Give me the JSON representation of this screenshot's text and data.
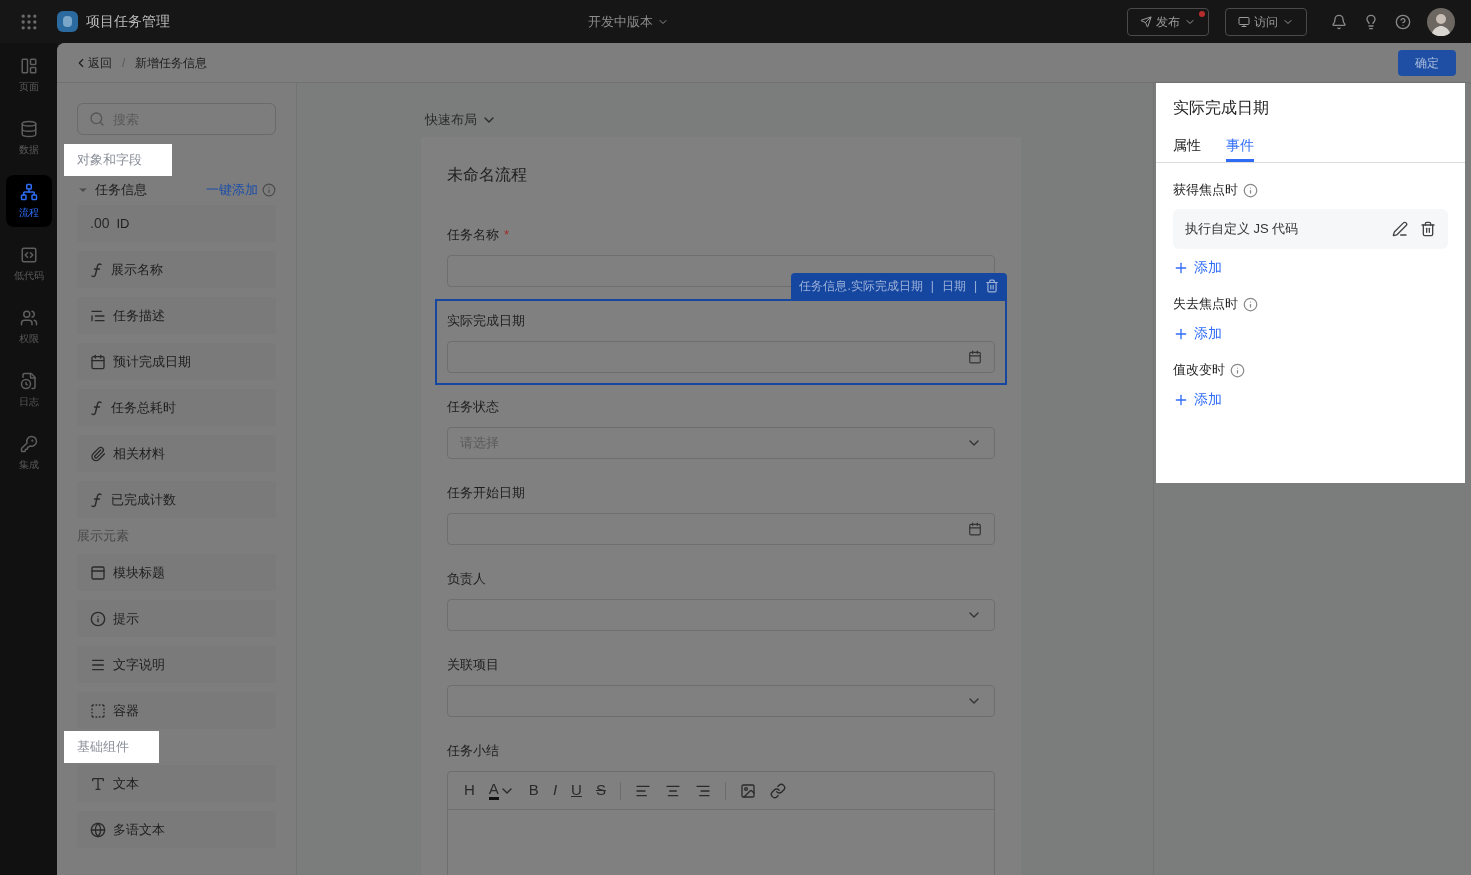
{
  "top_bar": {
    "app_title": "项目任务管理",
    "version": "开发中版本",
    "publish": {
      "label": "发布",
      "has_update": true
    },
    "visit": {
      "label": "访问"
    }
  },
  "nav": [
    {
      "label": "页面",
      "selected": false
    },
    {
      "label": "数据",
      "selected": false
    },
    {
      "label": "流程",
      "selected": true
    },
    {
      "label": "低代码",
      "selected": false
    },
    {
      "label": "权限",
      "selected": false
    },
    {
      "label": "日志",
      "selected": false
    },
    {
      "label": "集成",
      "selected": false
    }
  ],
  "header": {
    "back": "返回",
    "separator": "/",
    "page_title": "新增任务信息",
    "confirm": "确定"
  },
  "library": {
    "search_placeholder": "搜索",
    "sections": [
      {
        "title": "对象和字段",
        "highlighted": true,
        "group": {
          "title": "任务信息",
          "expanded": true,
          "action": "一键添加"
        },
        "items": [
          {
            "kind": "number",
            "glyph": ".00",
            "label": "ID"
          },
          {
            "kind": "formula",
            "label": "展示名称"
          },
          {
            "kind": "multiline",
            "label": "任务描述"
          },
          {
            "kind": "date",
            "label": "预计完成日期"
          },
          {
            "kind": "formula",
            "label": "任务总耗时"
          },
          {
            "kind": "attachment",
            "label": "相关材料"
          },
          {
            "kind": "formula",
            "label": "已完成计数"
          }
        ]
      },
      {
        "title": "展示元素",
        "highlighted": false,
        "items": [
          {
            "kind": "title",
            "label": "模块标题"
          },
          {
            "kind": "tip",
            "label": "提示"
          },
          {
            "kind": "lines",
            "label": "文字说明"
          },
          {
            "kind": "container",
            "label": "容器"
          }
        ]
      },
      {
        "title": "基础组件",
        "highlighted": true,
        "items": [
          {
            "kind": "text",
            "label": "文本"
          },
          {
            "kind": "globe",
            "label": "多语文本"
          }
        ]
      }
    ]
  },
  "canvas": {
    "layout_menu": "快速布局",
    "form_title": "未命名流程",
    "selection_tag": {
      "path": "任务信息.实际完成日期",
      "separator_1": "|",
      "type": "日期",
      "separator_2": "|"
    },
    "fields": [
      {
        "kind": "text",
        "label": "任务名称",
        "required_mark": "*",
        "selected": false
      },
      {
        "kind": "date",
        "label": "实际完成日期",
        "selected": true
      },
      {
        "kind": "select",
        "label": "任务状态",
        "placeholder": "请选择",
        "selected": false
      },
      {
        "kind": "date",
        "label": "任务开始日期",
        "selected": false
      },
      {
        "kind": "select",
        "label": "负责人",
        "selected": false
      },
      {
        "kind": "select",
        "label": "关联项目",
        "selected": false
      },
      {
        "kind": "richtext",
        "label": "任务小结",
        "selected": false
      }
    ],
    "editor_toolbar": [
      {
        "kind": "heading",
        "label": "H"
      },
      {
        "kind": "color",
        "label": "A"
      },
      {
        "kind": "bold",
        "label": "B"
      },
      {
        "kind": "italic",
        "label": "I"
      },
      {
        "kind": "underline",
        "label": "U"
      },
      {
        "kind": "strike",
        "label": "S"
      },
      {
        "kind": "divider"
      },
      {
        "kind": "align-left"
      },
      {
        "kind": "align-center"
      },
      {
        "kind": "align-right"
      },
      {
        "kind": "divider"
      },
      {
        "kind": "image"
      },
      {
        "kind": "link"
      }
    ]
  },
  "inspector": {
    "title": "实际完成日期",
    "tabs": [
      {
        "label": "属性",
        "selected": false
      },
      {
        "label": "事件",
        "selected": true
      }
    ],
    "events": [
      {
        "title": "获得焦点时",
        "actions": [
          "执行自定义 JS 代码"
        ],
        "add": "添加"
      },
      {
        "title": "失去焦点时",
        "add": "添加"
      },
      {
        "title": "值改变时",
        "add": "添加"
      }
    ]
  }
}
